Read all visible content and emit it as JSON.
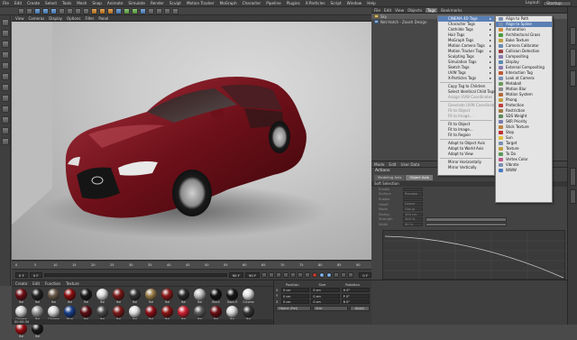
{
  "menubar": {
    "items": [
      "File",
      "Edit",
      "Create",
      "Select",
      "Tools",
      "Mesh",
      "Snap",
      "Animate",
      "Simulate",
      "Render",
      "Sculpt",
      "Motion Tracker",
      "MoGraph",
      "Character",
      "Pipeline",
      "Plugins",
      "X-Particles",
      "Script",
      "Window",
      "Help"
    ],
    "layout_label": "Layout:",
    "layout_value": "Startup"
  },
  "viewport": {
    "menu": [
      "View",
      "Cameras",
      "Display",
      "Options",
      "Filter",
      "Panel"
    ],
    "car_color": "#7a1420",
    "brand_badge": "infiniti-logo"
  },
  "timeline": {
    "ticks": [
      "0",
      "5",
      "10",
      "15",
      "20",
      "25",
      "30",
      "35",
      "40",
      "45",
      "50",
      "55",
      "60",
      "65",
      "70",
      "75",
      "80",
      "85",
      "90"
    ],
    "start_frame": "0 F",
    "current_frame": "0 F",
    "end_frame": "90 F",
    "end_frame_right": "90 F",
    "frame_right": "0 F"
  },
  "materials": {
    "menu": [
      "Create",
      "Edit",
      "Function",
      "Texture"
    ],
    "row1": [
      {
        "label": "Mat",
        "color": "#6e0f16"
      },
      {
        "label": "Mat",
        "color": "#222"
      },
      {
        "label": "Mat",
        "color": "#6a5b4c"
      },
      {
        "label": "Mat",
        "color": "#8a0f10"
      },
      {
        "label": "Mat",
        "color": "#1a1a1a"
      },
      {
        "label": "Mat",
        "color": "#dcdcdc"
      },
      {
        "label": "Mat",
        "color": "#7a1a1a"
      },
      {
        "label": "Mat",
        "color": "#333"
      },
      {
        "label": "Mat",
        "color": "#9a7d4a"
      },
      {
        "label": "Mat",
        "color": "#8a1a1a"
      },
      {
        "label": "Mat",
        "color": "#2a2a2a"
      },
      {
        "label": "Mat",
        "color": "#bfbfbf"
      },
      {
        "label": "Black",
        "color": "#111"
      },
      {
        "label": "Black-R",
        "color": "#181818"
      },
      {
        "label": "Chrome",
        "color": "#e0e0e0"
      },
      {
        "label": "Chrome",
        "color": "#cfcfcf"
      },
      {
        "label": "Mat",
        "color": "#9a9a9a"
      },
      {
        "label": "Chrome",
        "color": "#d5d5d5"
      }
    ],
    "row2": [
      {
        "label": "Blue",
        "color": "#1a3f8a"
      },
      {
        "label": "Mat",
        "color": "#5a0d13"
      },
      {
        "label": "Mat",
        "color": "#4a4a4a"
      },
      {
        "label": "Mat",
        "color": "#7d1a1a"
      },
      {
        "label": "Mat",
        "color": "#e0e0e0"
      },
      {
        "label": "Mat",
        "color": "#8a0f16"
      },
      {
        "label": "Mat",
        "color": "#8a1414"
      },
      {
        "label": "Mat",
        "color": "#c23"
      },
      {
        "label": "Mat",
        "color": "#5a5a5a"
      },
      {
        "label": "Mat",
        "color": "#6a0f14"
      },
      {
        "label": "Mat",
        "color": "#d8d8d8"
      },
      {
        "label": "Mat",
        "color": "#333"
      },
      {
        "label": "Mat",
        "color": "#9a0f14"
      },
      {
        "label": "Mat",
        "color": "#1a1a1a"
      }
    ]
  },
  "coords": {
    "headers": [
      "Position",
      "Size",
      "Rotation"
    ],
    "rows": [
      {
        "axis": "X",
        "pos": "0 cm",
        "size": "0 cm",
        "rot": "H 0°"
      },
      {
        "axis": "Y",
        "pos": "0 cm",
        "size": "0 cm",
        "rot": "P 0°"
      },
      {
        "axis": "Z",
        "pos": "0 cm",
        "size": "0 cm",
        "rot": "B 0°"
      }
    ],
    "mode": "Object (Rel)",
    "size_mode": "Size",
    "apply": "Apply"
  },
  "status": "00:00:34",
  "objmgr": {
    "menu": [
      "File",
      "Edit",
      "View",
      "Objects",
      "Tags",
      "Bookmarks"
    ],
    "active_menu": "Tags",
    "rows": [
      {
        "label": "Sky"
      },
      {
        "label": "Net Hatch - Zooch Design"
      }
    ]
  },
  "tags_menu": {
    "items": [
      {
        "label": "CINEMA 4D Tags",
        "arrow": "▸",
        "hl": true
      },
      {
        "label": "Character Tags",
        "arrow": "▸"
      },
      {
        "label": "Clothilde Tags",
        "arrow": "▸"
      },
      {
        "label": "Hair Tags",
        "arrow": "▸"
      },
      {
        "label": "MoGraph Tags",
        "arrow": "▸"
      },
      {
        "label": "Motion Camera Tags",
        "arrow": "▸"
      },
      {
        "label": "Motion Tracker Tags",
        "arrow": "▸"
      },
      {
        "label": "Sculpting Tags",
        "arrow": "▸"
      },
      {
        "label": "Simulation Tags",
        "arrow": "▸"
      },
      {
        "label": "Sketch Tags",
        "arrow": "▸"
      },
      {
        "label": "UVW Tags",
        "arrow": "▸"
      },
      {
        "label": "X-Particles Tags",
        "arrow": "▸"
      },
      {
        "sep": true
      },
      {
        "label": "Copy Tag to Children"
      },
      {
        "label": "Select Identical Child Tags"
      },
      {
        "label": "Assign UVW Coordinates",
        "dis": true
      },
      {
        "sep": true
      },
      {
        "label": "Generate UVW Coordinates",
        "dis": true
      },
      {
        "label": "Fit to Object",
        "dis": true
      },
      {
        "label": "Fit to Image...",
        "dis": true
      },
      {
        "sep": true
      },
      {
        "label": "Fit to Object"
      },
      {
        "label": "Fit to Image..."
      },
      {
        "label": "Fit to Region"
      },
      {
        "sep": true
      },
      {
        "label": "Adapt to Object Axis"
      },
      {
        "label": "Adapt to World Axis"
      },
      {
        "label": "Adapt to View"
      },
      {
        "sep": true
      },
      {
        "label": "Mirror Horizontally"
      },
      {
        "label": "Mirror Vertically"
      }
    ]
  },
  "c4d_tags_menu": {
    "items": [
      {
        "label": "Align to Path",
        "color": "#7a8fb0"
      },
      {
        "label": "Align to Spline",
        "color": "#7a8fb0",
        "hl": true
      },
      {
        "label": "Annotation",
        "color": "#d08a3a"
      },
      {
        "label": "Architectural Grass",
        "color": "#4a9a3a"
      },
      {
        "label": "Bake Texture",
        "color": "#c0a040"
      },
      {
        "label": "Camera Calibrator",
        "color": "#6a8ab0"
      },
      {
        "label": "Collision Detection",
        "color": "#a04040"
      },
      {
        "label": "Compositing",
        "color": "#8a7ab0"
      },
      {
        "label": "Display",
        "color": "#5a8ab0"
      },
      {
        "label": "External Compositing",
        "color": "#8a7ab0"
      },
      {
        "label": "Interaction Tag",
        "color": "#c05a30"
      },
      {
        "label": "Look at Camera",
        "color": "#7a8fb0"
      },
      {
        "label": "Metaball",
        "color": "#6a9a5a"
      },
      {
        "label": "Motion Blur",
        "color": "#8a8a8a"
      },
      {
        "label": "Motion System",
        "color": "#b06a3a"
      },
      {
        "label": "Phong",
        "color": "#c0a040"
      },
      {
        "label": "Protection",
        "color": "#c04040"
      },
      {
        "label": "Restriction",
        "color": "#a07a40"
      },
      {
        "label": "SDS Weight",
        "color": "#5a8a5a"
      },
      {
        "label": "SKR Priority",
        "color": "#7a7ab0"
      },
      {
        "label": "Stick Texture",
        "color": "#c08040"
      },
      {
        "label": "Stop",
        "color": "#c03030"
      },
      {
        "label": "Sun",
        "color": "#e0c040"
      },
      {
        "label": "Target",
        "color": "#7a8fb0"
      },
      {
        "label": "Texture",
        "color": "#c0a040"
      },
      {
        "label": "To Do",
        "color": "#5a9a5a"
      },
      {
        "label": "Vertex Color",
        "color": "#c05a8a"
      },
      {
        "label": "Vibrate",
        "color": "#7a8fb0"
      },
      {
        "label": "WWW",
        "color": "#4a7ac0"
      }
    ]
  },
  "attr": {
    "menu": [
      "Mode",
      "Edit",
      "User Data"
    ],
    "title": "Actions",
    "tabs": [
      "Modeling Axis",
      "Object Axis",
      "Soft Selection"
    ],
    "section": "Soft Selection",
    "rows": [
      {
        "label": "Enable",
        "val": "",
        "bar": false
      },
      {
        "label": "Surface",
        "val": "Preview",
        "bar": false
      },
      {
        "label": "Rubber",
        "val": "",
        "bar": false
      },
      {
        "label": "Falloff",
        "val": "Linear",
        "bar": false
      },
      {
        "label": "Mode",
        "val": "Group",
        "bar": false
      },
      {
        "label": "Radius",
        "val": "100 cm",
        "bar": false
      },
      {
        "label": "Strength",
        "val": "100 %",
        "bar": true
      },
      {
        "label": "Width",
        "val": "50 %",
        "bar": true
      }
    ]
  }
}
